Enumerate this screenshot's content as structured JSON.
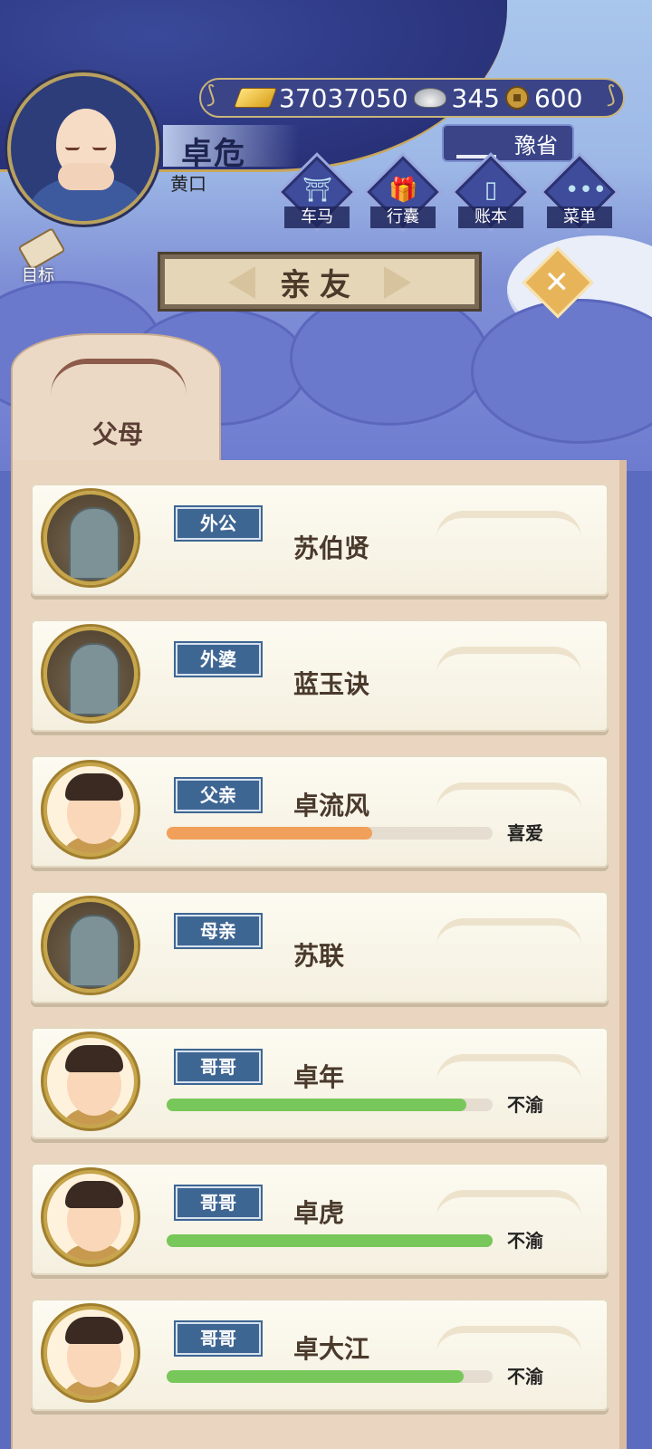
{
  "header": {
    "player_name": "卓危",
    "player_title": "黄口",
    "gold": "37037050",
    "silver": "345",
    "coins": "600",
    "province": "豫省"
  },
  "menu": [
    {
      "label": "车马",
      "icon": "carriage-icon"
    },
    {
      "label": "行囊",
      "icon": "bag-icon"
    },
    {
      "label": "账本",
      "icon": "ledger-icon"
    },
    {
      "label": "菜单",
      "icon": "more-icon"
    }
  ],
  "goal_label": "目标",
  "page_title": "亲友",
  "tab_label": "父母",
  "colors": {
    "navy": "#2c3680",
    "relation_badge": "#3e6693",
    "bar_orange": "#f0a05a",
    "bar_green": "#78c75a"
  },
  "relatives": [
    {
      "relation": "外公",
      "name": "苏伯贤",
      "portrait": "grave",
      "mood": "",
      "affinity": null,
      "bar_color": ""
    },
    {
      "relation": "外婆",
      "name": "蓝玉诀",
      "portrait": "grave",
      "mood": "",
      "affinity": null,
      "bar_color": ""
    },
    {
      "relation": "父亲",
      "name": "卓流风",
      "portrait": "person",
      "mood": "喜爱",
      "affinity": 0.63,
      "bar_color": "#f0a05a"
    },
    {
      "relation": "母亲",
      "name": "苏联",
      "portrait": "grave",
      "mood": "",
      "affinity": null,
      "bar_color": ""
    },
    {
      "relation": "哥哥",
      "name": "卓年",
      "portrait": "person",
      "mood": "不渝",
      "affinity": 0.92,
      "bar_color": "#78c75a"
    },
    {
      "relation": "哥哥",
      "name": "卓虎",
      "portrait": "person",
      "mood": "不渝",
      "affinity": 1.0,
      "bar_color": "#78c75a"
    },
    {
      "relation": "哥哥",
      "name": "卓大江",
      "portrait": "person",
      "mood": "不渝",
      "affinity": 0.91,
      "bar_color": "#78c75a"
    }
  ]
}
